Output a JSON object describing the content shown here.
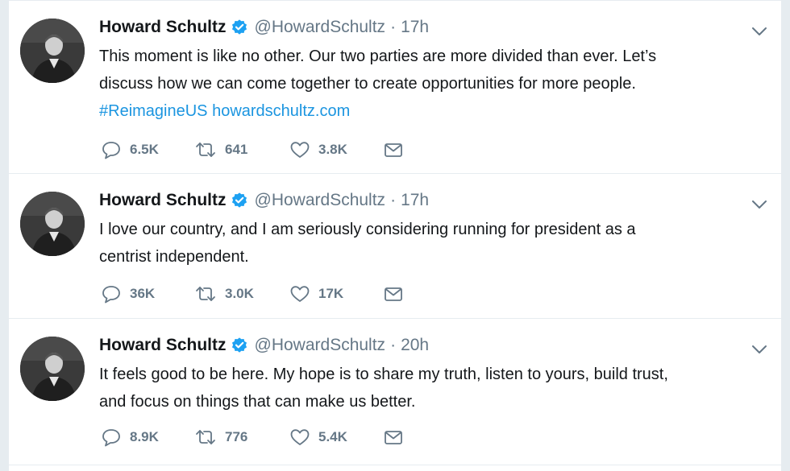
{
  "tweets": [
    {
      "name": "Howard Schultz",
      "handle": "@HowardSchultz",
      "separator": "·",
      "time": "17h",
      "lines": [
        "This moment is like no other. Our two parties are more divided than ever. Let’s",
        "discuss how we can come together to create opportunities for more people."
      ],
      "hashtag": "#ReimagineUS",
      "link": "howardschultz.com",
      "replies": "6.5K",
      "retweets": "641",
      "likes": "3.8K"
    },
    {
      "name": "Howard Schultz",
      "handle": "@HowardSchultz",
      "separator": "·",
      "time": "17h",
      "lines": [
        "I love our country, and I am seriously considering running for president as a",
        "centrist independent."
      ],
      "replies": "36K",
      "retweets": "3.0K",
      "likes": "17K"
    },
    {
      "name": "Howard Schultz",
      "handle": "@HowardSchultz",
      "separator": "·",
      "time": "20h",
      "lines": [
        "It feels good to be here. My hope is to share my truth, listen to yours, build trust,",
        "and focus on things that can make us better."
      ],
      "replies": "8.9K",
      "retweets": "776",
      "likes": "5.4K"
    }
  ],
  "icons": {
    "verified": "verified-badge-icon",
    "caret": "chevron-down-icon",
    "reply": "reply-icon",
    "retweet": "retweet-icon",
    "like": "heart-icon",
    "message": "envelope-icon"
  },
  "colors": {
    "text": "#14171a",
    "secondary": "#657786",
    "link": "#1b95e0",
    "verified": "#1da1f2",
    "divider": "#e6ecf0"
  }
}
